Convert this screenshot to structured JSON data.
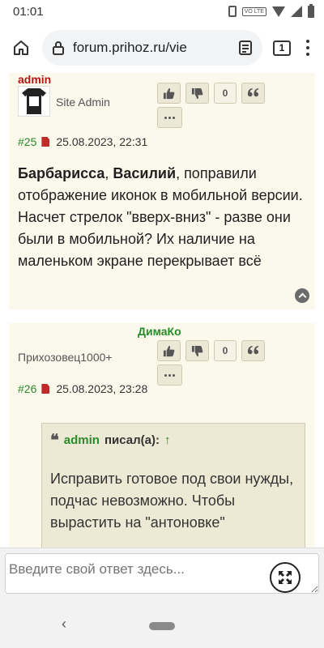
{
  "status_bar": {
    "time": "01:01",
    "lte_label": "VO LTE"
  },
  "browser": {
    "url": "forum.prihoz.ru/vie",
    "tab_count": "1"
  },
  "posts": [
    {
      "author": "admin",
      "rank": "Site Admin",
      "vote_count": "0",
      "number": "#25",
      "date": "25.08.2023, 22:31",
      "body_bold_1": "Барбарисса",
      "body_sep": ", ",
      "body_bold_2": "Василий",
      "body_text": ", поправили отображение иконок в мобильной версии. Насчет стрелок \"вверх-вниз\" - разве они были в мобильной? Их наличие на маленьком экране перекрывает всё"
    },
    {
      "author": "ДимаКо",
      "rank": "Прихозовец1000+",
      "vote_count": "0",
      "number": "#26",
      "date": "25.08.2023, 23:28",
      "quote": {
        "author": "admin",
        "wrote": "писал(а):",
        "arrow": "↑",
        "text": "Исправить готовое под свои нужды, подчас невозможно. Чтобы вырастить на \"антоновке\""
      }
    }
  ],
  "reply": {
    "placeholder": "Введите свой ответ здесь..."
  },
  "nav": {
    "back_glyph": "‹"
  },
  "colors": {
    "post_bg": "#fbf8ec",
    "admin_name": "#b41515",
    "user_name": "#2b8a2b",
    "quote_bg": "#ece9d4"
  }
}
